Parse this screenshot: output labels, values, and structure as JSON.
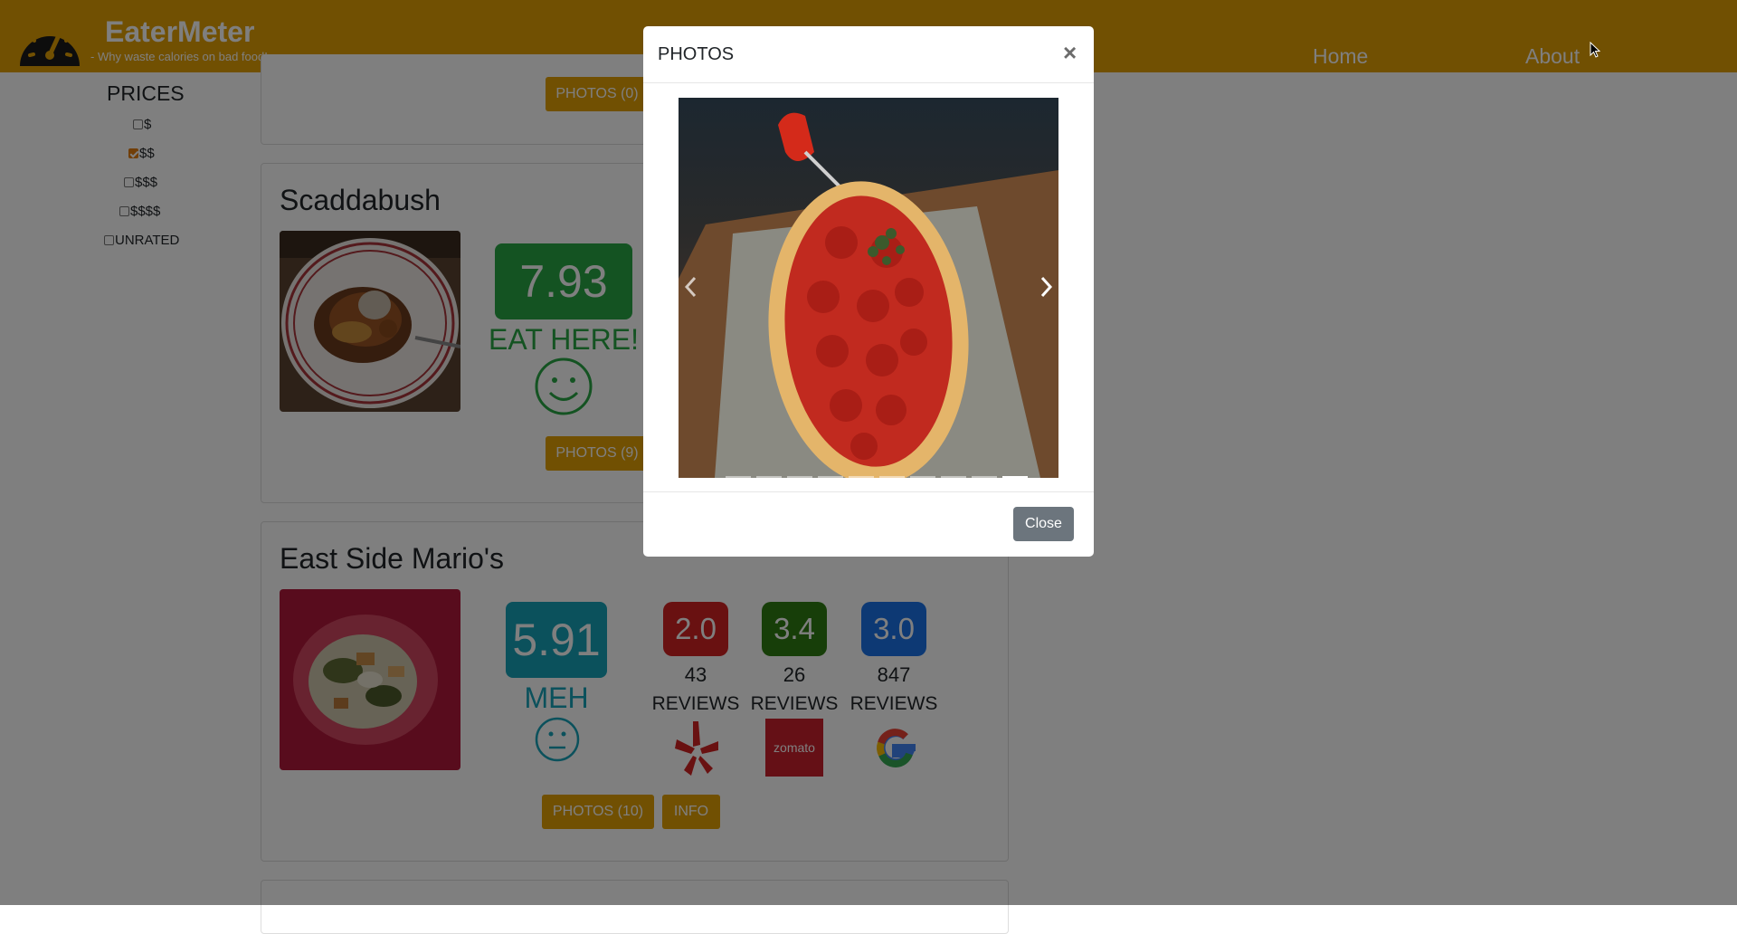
{
  "header": {
    "brand": "EaterMeter",
    "tagline": "- Why waste calories on bad food!",
    "nav": {
      "home": "Home",
      "about": "About"
    }
  },
  "sidebar": {
    "title": "PRICES",
    "options": [
      {
        "label": "$",
        "checked": false
      },
      {
        "label": "$$",
        "checked": true
      },
      {
        "label": "$$$",
        "checked": false
      },
      {
        "label": "$$$$",
        "checked": false
      },
      {
        "label": "UNRATED",
        "checked": false
      }
    ]
  },
  "cards": {
    "top": {
      "photos_label": "PHOTOS (0)"
    },
    "scaddabush": {
      "name": "Scaddabush",
      "score": "7.93",
      "verdict": "EAT HERE!",
      "photos_label": "PHOTOS (9)",
      "color": "#28a745"
    },
    "eastside": {
      "name": "East Side Mario's",
      "score": "5.91",
      "verdict": "MEH",
      "score_color": "#17a2b8",
      "photos_label": "PHOTOS (10)",
      "info_label": "INFO",
      "reviews": [
        {
          "rating": "2.0",
          "count": "43",
          "label": "REVIEWS",
          "source": "yelp-icon",
          "color": "#d32323"
        },
        {
          "rating": "3.4",
          "count": "26",
          "label": "REVIEWS",
          "source": "zomato-icon",
          "color": "#2e7d12",
          "logo_text": "zomato"
        },
        {
          "rating": "3.0",
          "count": "847",
          "label": "REVIEWS",
          "source": "google-icon",
          "color": "#1a73e8"
        }
      ]
    }
  },
  "modal": {
    "title": "PHOTOS",
    "close_x": "×",
    "close_label": "Close",
    "slide_count": 10,
    "active_slide": 10
  }
}
